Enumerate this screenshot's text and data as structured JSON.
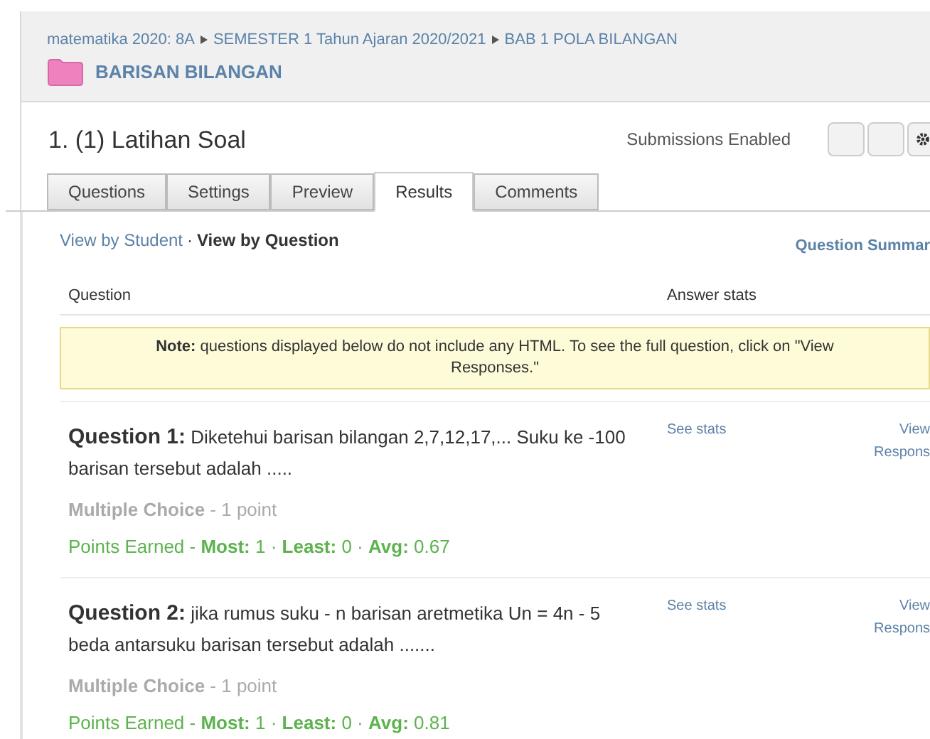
{
  "breadcrumb": [
    "matematika 2020: 8A",
    "SEMESTER 1 Tahun Ajaran 2020/2021",
    "BAB 1 POLA BILANGAN"
  ],
  "folder": "BARISAN BILANGAN",
  "title": "1. (1) Latihan Soal",
  "status": "Submissions Enabled",
  "tabs": [
    {
      "label": "Questions",
      "selected": false
    },
    {
      "label": "Settings",
      "selected": false
    },
    {
      "label": "Preview",
      "selected": false
    },
    {
      "label": "Results",
      "selected": true
    },
    {
      "label": "Comments",
      "selected": false
    }
  ],
  "views": [
    {
      "label": "View by Student",
      "selected": false
    },
    {
      "label": "View by Question",
      "selected": true
    }
  ],
  "views_separator": "·",
  "summary_link": "Question Summar",
  "columns": [
    "Question",
    "Answer stats"
  ],
  "note": "**Note:** questions displayed below do not include any HTML. To see the full question, click on \"View Responses.\"",
  "questions": [
    {
      "text": "**Question 1:**  Diketehui barisan bilangan 2,7,12,17,... Suku ke -100 barisan tersebut adalah .....",
      "type": "**Multiple Choice** - 1 point",
      "points": "Points Earned - **Most:** 1 · **Least:** 0 · **Avg:** 0.67",
      "stats_link": "See stats",
      "view_link": [
        "View",
        "Respons"
      ]
    },
    {
      "text": "**Question 2:** jika rumus suku - n barisan aretmetika  Un = 4n - 5 beda antarsuku barisan tersebut adalah .......",
      "type": "**Multiple Choice** - 1 point",
      "points": "Points Earned - **Most:** 1 · **Least:** 0 · **Avg:** 0.81",
      "stats_link": "See stats",
      "view_link": [
        "View",
        "Respons"
      ]
    }
  ]
}
